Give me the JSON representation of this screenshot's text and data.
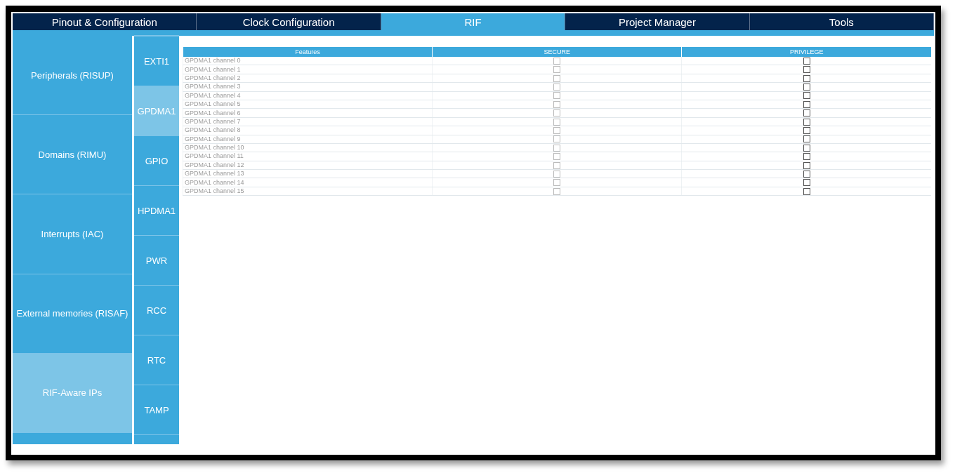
{
  "tabs": [
    {
      "label": "Pinout & Configuration",
      "selected": false
    },
    {
      "label": "Clock Configuration",
      "selected": false
    },
    {
      "label": "RIF",
      "selected": true
    },
    {
      "label": "Project Manager",
      "selected": false
    },
    {
      "label": "Tools",
      "selected": false
    }
  ],
  "categories": [
    {
      "label": "Peripherals (RISUP)",
      "selected": false
    },
    {
      "label": "Domains (RIMU)",
      "selected": false
    },
    {
      "label": "Interrupts (IAC)",
      "selected": false
    },
    {
      "label": "External memories (RISAF)",
      "selected": false
    },
    {
      "label": "RIF-Aware IPs",
      "selected": true
    }
  ],
  "ips": [
    {
      "label": "EXTI1",
      "selected": false
    },
    {
      "label": "GPDMA1",
      "selected": true
    },
    {
      "label": "GPIO",
      "selected": false
    },
    {
      "label": "HPDMA1",
      "selected": false
    },
    {
      "label": "PWR",
      "selected": false
    },
    {
      "label": "RCC",
      "selected": false
    },
    {
      "label": "RTC",
      "selected": false
    },
    {
      "label": "TAMP",
      "selected": false
    }
  ],
  "table": {
    "columns": [
      "Features",
      "SECURE",
      "PRIVILEGE"
    ],
    "rows": [
      {
        "feature": "GPDMA1 channel 0",
        "secure": {
          "checked": false,
          "disabled": true
        },
        "privilege": {
          "checked": false,
          "disabled": false
        }
      },
      {
        "feature": "GPDMA1 channel 1",
        "secure": {
          "checked": false,
          "disabled": true
        },
        "privilege": {
          "checked": false,
          "disabled": false
        }
      },
      {
        "feature": "GPDMA1 channel 2",
        "secure": {
          "checked": false,
          "disabled": true
        },
        "privilege": {
          "checked": false,
          "disabled": false
        }
      },
      {
        "feature": "GPDMA1 channel 3",
        "secure": {
          "checked": false,
          "disabled": true
        },
        "privilege": {
          "checked": false,
          "disabled": false
        }
      },
      {
        "feature": "GPDMA1 channel 4",
        "secure": {
          "checked": false,
          "disabled": true
        },
        "privilege": {
          "checked": false,
          "disabled": false
        }
      },
      {
        "feature": "GPDMA1 channel 5",
        "secure": {
          "checked": false,
          "disabled": true
        },
        "privilege": {
          "checked": false,
          "disabled": false
        }
      },
      {
        "feature": "GPDMA1 channel 6",
        "secure": {
          "checked": false,
          "disabled": true
        },
        "privilege": {
          "checked": false,
          "disabled": false
        }
      },
      {
        "feature": "GPDMA1 channel 7",
        "secure": {
          "checked": false,
          "disabled": true
        },
        "privilege": {
          "checked": false,
          "disabled": false
        }
      },
      {
        "feature": "GPDMA1 channel 8",
        "secure": {
          "checked": false,
          "disabled": true
        },
        "privilege": {
          "checked": false,
          "disabled": false
        }
      },
      {
        "feature": "GPDMA1 channel 9",
        "secure": {
          "checked": false,
          "disabled": true
        },
        "privilege": {
          "checked": false,
          "disabled": false
        }
      },
      {
        "feature": "GPDMA1 channel 10",
        "secure": {
          "checked": false,
          "disabled": true
        },
        "privilege": {
          "checked": false,
          "disabled": false
        }
      },
      {
        "feature": "GPDMA1 channel 11",
        "secure": {
          "checked": false,
          "disabled": true
        },
        "privilege": {
          "checked": false,
          "disabled": false
        }
      },
      {
        "feature": "GPDMA1 channel 12",
        "secure": {
          "checked": false,
          "disabled": true
        },
        "privilege": {
          "checked": false,
          "disabled": false
        }
      },
      {
        "feature": "GPDMA1 channel 13",
        "secure": {
          "checked": false,
          "disabled": true
        },
        "privilege": {
          "checked": false,
          "disabled": false
        }
      },
      {
        "feature": "GPDMA1 channel 14",
        "secure": {
          "checked": false,
          "disabled": true
        },
        "privilege": {
          "checked": false,
          "disabled": false
        }
      },
      {
        "feature": "GPDMA1 channel 15",
        "secure": {
          "checked": false,
          "disabled": true
        },
        "privilege": {
          "checked": false,
          "disabled": false
        }
      }
    ]
  }
}
